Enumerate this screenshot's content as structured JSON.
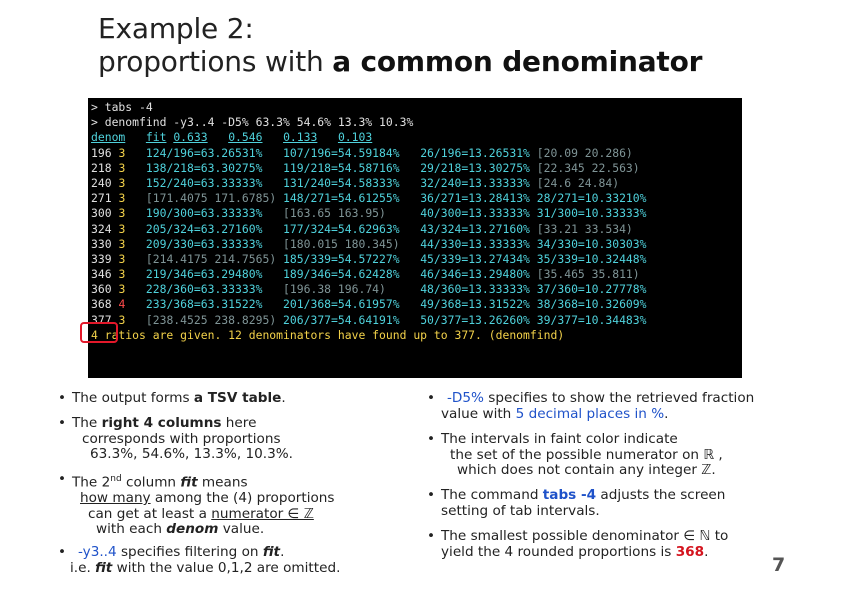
{
  "title": {
    "line1": "Example 2:",
    "line2_prefix": "proportions with ",
    "line2_bold": "a common denominator"
  },
  "terminal": {
    "cmd1": "> tabs -4",
    "cmd2": "> denomfind -y3..4 -D5% 63.3% 54.6% 13.3% 10.3%",
    "header": {
      "denom": "denom",
      "fit": "fit",
      "h1": "0.633",
      "h2": "0.546",
      "h3": "0.133",
      "h4": "0.103"
    },
    "footer": "4 ratios are given. 12 denominators have found up to 377. (denomfind)",
    "rows": [
      {
        "d": "196",
        "f": "3",
        "c": [
          "124/196=63.26531%",
          "107/196=54.59184%",
          "26/196=13.26531%",
          "[20.09 20.286)"
        ],
        "faint": [
          3
        ]
      },
      {
        "d": "218",
        "f": "3",
        "c": [
          "138/218=63.30275%",
          "119/218=54.58716%",
          "29/218=13.30275%",
          "[22.345 22.563)"
        ],
        "faint": [
          3
        ]
      },
      {
        "d": "240",
        "f": "3",
        "c": [
          "152/240=63.33333%",
          "131/240=54.58333%",
          "32/240=13.33333%",
          "[24.6 24.84)"
        ],
        "faint": [
          3
        ]
      },
      {
        "d": "271",
        "f": "3",
        "c": [
          "[171.4075 171.6785)",
          "148/271=54.61255%",
          "36/271=13.28413%",
          "28/271=10.33210%"
        ],
        "faint": [
          0
        ]
      },
      {
        "d": "300",
        "f": "3",
        "c": [
          "190/300=63.33333%",
          "[163.65 163.95)",
          "40/300=13.33333%",
          "31/300=10.33333%"
        ],
        "faint": [
          1
        ]
      },
      {
        "d": "324",
        "f": "3",
        "c": [
          "205/324=63.27160%",
          "177/324=54.62963%",
          "43/324=13.27160%",
          "[33.21 33.534)"
        ],
        "faint": [
          3
        ]
      },
      {
        "d": "330",
        "f": "3",
        "c": [
          "209/330=63.33333%",
          "[180.015 180.345)",
          "44/330=13.33333%",
          "34/330=10.30303%"
        ],
        "faint": [
          1
        ]
      },
      {
        "d": "339",
        "f": "3",
        "c": [
          "[214.4175 214.7565)",
          "185/339=54.57227%",
          "45/339=13.27434%",
          "35/339=10.32448%"
        ],
        "faint": [
          0
        ]
      },
      {
        "d": "346",
        "f": "3",
        "c": [
          "219/346=63.29480%",
          "189/346=54.62428%",
          "46/346=13.29480%",
          "[35.465 35.811)"
        ],
        "faint": [
          3
        ]
      },
      {
        "d": "360",
        "f": "3",
        "c": [
          "228/360=63.33333%",
          "[196.38 196.74)",
          "48/360=13.33333%",
          "37/360=10.27778%"
        ],
        "faint": [
          1
        ]
      },
      {
        "d": "368",
        "f": "4",
        "c": [
          "233/368=63.31522%",
          "201/368=54.61957%",
          "49/368=13.31522%",
          "38/368=10.32609%"
        ],
        "faint": []
      },
      {
        "d": "377",
        "f": "3",
        "c": [
          "[238.4525 238.8295)",
          "206/377=54.64191%",
          "50/377=13.26260%",
          "39/377=10.34483%"
        ],
        "faint": [
          0
        ]
      }
    ]
  },
  "left_bullets": {
    "b1": {
      "pre": "The output forms ",
      "bold": "a TSV table",
      "post": "."
    },
    "b2": {
      "pre": "The ",
      "bold": "right 4 columns",
      "post": " here",
      "l2": "corresponds with proportions",
      "l3": "63.3%, 54.6%, 13.3%, 10.3%."
    },
    "b3": {
      "pre": "The 2",
      "sup": "nd",
      "mid": " column ",
      "it": "fit",
      "post": " means",
      "l2u": "how many",
      "l2": " among the (4) proportions",
      "l3a": "can get at least a ",
      "l3u": "numerator ∈ ℤ",
      "l4a": "with each ",
      "l4it": "denom",
      "l4b": " value."
    },
    "b4": {
      "blue": "-y3..4",
      "pre": " specifies filtering on ",
      "it": "fit",
      "post": ".",
      "l2a": "i.e. ",
      "l2it": "fit",
      "l2b": " with the value 0,1,2 are omitted."
    }
  },
  "right_bullets": {
    "b1": {
      "blue": "-D5%",
      "post": " specifies to show the retrieved fraction",
      "l2a": "value with ",
      "l2blue": "5 decimal places in %",
      "l2b": "."
    },
    "b2": {
      "l1": "The intervals in faint color indicate",
      "l2": "the set of the possible numerator on ℝ ,",
      "l3": "which does not contain any integer ℤ."
    },
    "b3": {
      "pre": "The command ",
      "blue": "tabs -4",
      "post": " adjusts the screen",
      "l2": "setting of tab intervals."
    },
    "b4": {
      "l1": "The smallest possible denominator ∈ ℕ  to",
      "l2a": "yield the 4 rounded proportions is ",
      "l2red": "368",
      "l2b": "."
    }
  },
  "page_number": "7"
}
